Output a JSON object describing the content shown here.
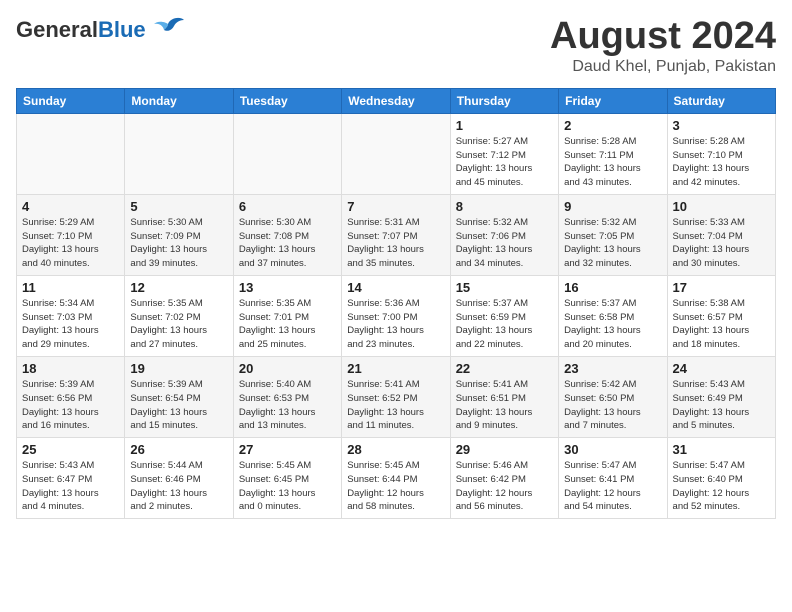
{
  "header": {
    "logo_general": "General",
    "logo_blue": "Blue",
    "month_title": "August 2024",
    "location": "Daud Khel, Punjab, Pakistan"
  },
  "columns": [
    "Sunday",
    "Monday",
    "Tuesday",
    "Wednesday",
    "Thursday",
    "Friday",
    "Saturday"
  ],
  "weeks": [
    [
      {
        "day": "",
        "info": ""
      },
      {
        "day": "",
        "info": ""
      },
      {
        "day": "",
        "info": ""
      },
      {
        "day": "",
        "info": ""
      },
      {
        "day": "1",
        "info": "Sunrise: 5:27 AM\nSunset: 7:12 PM\nDaylight: 13 hours\nand 45 minutes."
      },
      {
        "day": "2",
        "info": "Sunrise: 5:28 AM\nSunset: 7:11 PM\nDaylight: 13 hours\nand 43 minutes."
      },
      {
        "day": "3",
        "info": "Sunrise: 5:28 AM\nSunset: 7:10 PM\nDaylight: 13 hours\nand 42 minutes."
      }
    ],
    [
      {
        "day": "4",
        "info": "Sunrise: 5:29 AM\nSunset: 7:10 PM\nDaylight: 13 hours\nand 40 minutes."
      },
      {
        "day": "5",
        "info": "Sunrise: 5:30 AM\nSunset: 7:09 PM\nDaylight: 13 hours\nand 39 minutes."
      },
      {
        "day": "6",
        "info": "Sunrise: 5:30 AM\nSunset: 7:08 PM\nDaylight: 13 hours\nand 37 minutes."
      },
      {
        "day": "7",
        "info": "Sunrise: 5:31 AM\nSunset: 7:07 PM\nDaylight: 13 hours\nand 35 minutes."
      },
      {
        "day": "8",
        "info": "Sunrise: 5:32 AM\nSunset: 7:06 PM\nDaylight: 13 hours\nand 34 minutes."
      },
      {
        "day": "9",
        "info": "Sunrise: 5:32 AM\nSunset: 7:05 PM\nDaylight: 13 hours\nand 32 minutes."
      },
      {
        "day": "10",
        "info": "Sunrise: 5:33 AM\nSunset: 7:04 PM\nDaylight: 13 hours\nand 30 minutes."
      }
    ],
    [
      {
        "day": "11",
        "info": "Sunrise: 5:34 AM\nSunset: 7:03 PM\nDaylight: 13 hours\nand 29 minutes."
      },
      {
        "day": "12",
        "info": "Sunrise: 5:35 AM\nSunset: 7:02 PM\nDaylight: 13 hours\nand 27 minutes."
      },
      {
        "day": "13",
        "info": "Sunrise: 5:35 AM\nSunset: 7:01 PM\nDaylight: 13 hours\nand 25 minutes."
      },
      {
        "day": "14",
        "info": "Sunrise: 5:36 AM\nSunset: 7:00 PM\nDaylight: 13 hours\nand 23 minutes."
      },
      {
        "day": "15",
        "info": "Sunrise: 5:37 AM\nSunset: 6:59 PM\nDaylight: 13 hours\nand 22 minutes."
      },
      {
        "day": "16",
        "info": "Sunrise: 5:37 AM\nSunset: 6:58 PM\nDaylight: 13 hours\nand 20 minutes."
      },
      {
        "day": "17",
        "info": "Sunrise: 5:38 AM\nSunset: 6:57 PM\nDaylight: 13 hours\nand 18 minutes."
      }
    ],
    [
      {
        "day": "18",
        "info": "Sunrise: 5:39 AM\nSunset: 6:56 PM\nDaylight: 13 hours\nand 16 minutes."
      },
      {
        "day": "19",
        "info": "Sunrise: 5:39 AM\nSunset: 6:54 PM\nDaylight: 13 hours\nand 15 minutes."
      },
      {
        "day": "20",
        "info": "Sunrise: 5:40 AM\nSunset: 6:53 PM\nDaylight: 13 hours\nand 13 minutes."
      },
      {
        "day": "21",
        "info": "Sunrise: 5:41 AM\nSunset: 6:52 PM\nDaylight: 13 hours\nand 11 minutes."
      },
      {
        "day": "22",
        "info": "Sunrise: 5:41 AM\nSunset: 6:51 PM\nDaylight: 13 hours\nand 9 minutes."
      },
      {
        "day": "23",
        "info": "Sunrise: 5:42 AM\nSunset: 6:50 PM\nDaylight: 13 hours\nand 7 minutes."
      },
      {
        "day": "24",
        "info": "Sunrise: 5:43 AM\nSunset: 6:49 PM\nDaylight: 13 hours\nand 5 minutes."
      }
    ],
    [
      {
        "day": "25",
        "info": "Sunrise: 5:43 AM\nSunset: 6:47 PM\nDaylight: 13 hours\nand 4 minutes."
      },
      {
        "day": "26",
        "info": "Sunrise: 5:44 AM\nSunset: 6:46 PM\nDaylight: 13 hours\nand 2 minutes."
      },
      {
        "day": "27",
        "info": "Sunrise: 5:45 AM\nSunset: 6:45 PM\nDaylight: 13 hours\nand 0 minutes."
      },
      {
        "day": "28",
        "info": "Sunrise: 5:45 AM\nSunset: 6:44 PM\nDaylight: 12 hours\nand 58 minutes."
      },
      {
        "day": "29",
        "info": "Sunrise: 5:46 AM\nSunset: 6:42 PM\nDaylight: 12 hours\nand 56 minutes."
      },
      {
        "day": "30",
        "info": "Sunrise: 5:47 AM\nSunset: 6:41 PM\nDaylight: 12 hours\nand 54 minutes."
      },
      {
        "day": "31",
        "info": "Sunrise: 5:47 AM\nSunset: 6:40 PM\nDaylight: 12 hours\nand 52 minutes."
      }
    ]
  ]
}
